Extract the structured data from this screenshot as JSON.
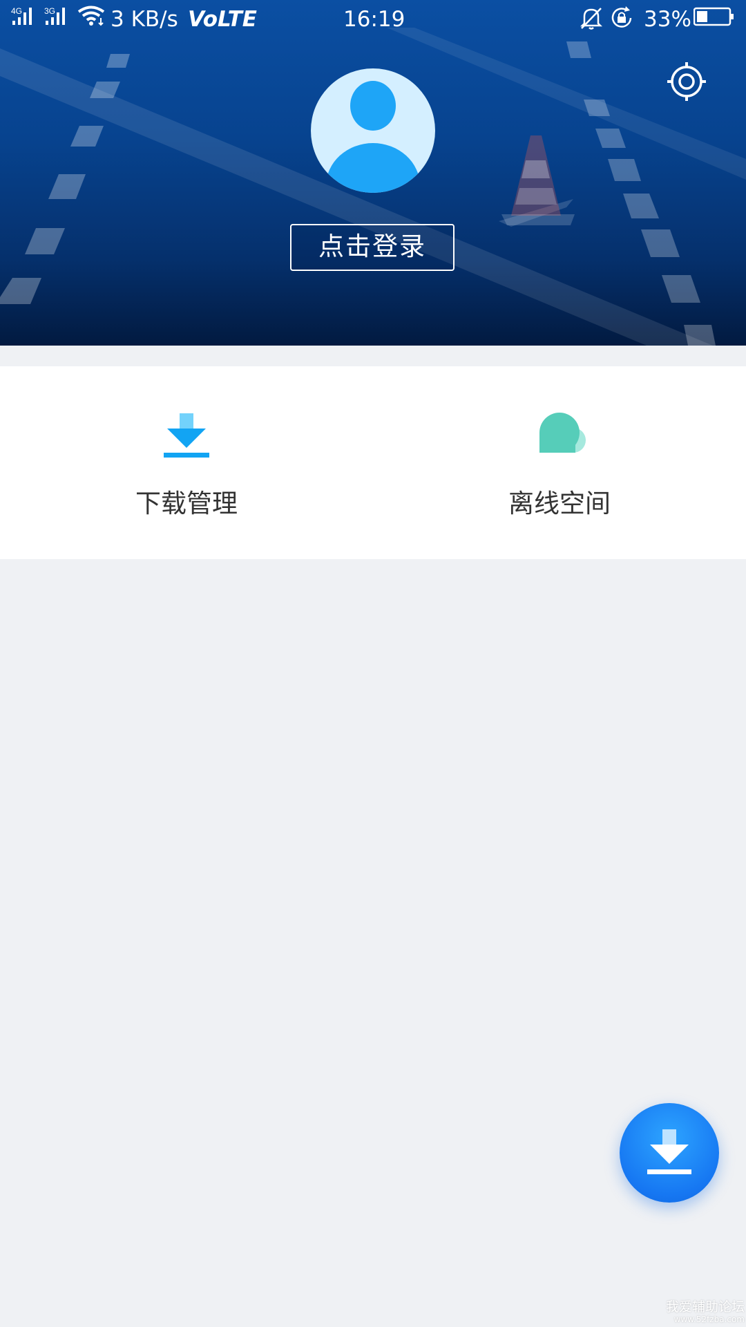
{
  "status_bar": {
    "network_1": "4G",
    "network_2": "3G",
    "speed": "3 KB/s",
    "volte": "VoLTE",
    "time": "16:19",
    "battery": "33%",
    "battery_level": 0.33
  },
  "header": {
    "login_label": "点击登录"
  },
  "quick_actions": [
    {
      "label": "下载管理",
      "icon": "download-icon"
    },
    {
      "label": "离线空间",
      "icon": "cloud-icon"
    }
  ],
  "fab": {
    "icon": "download-icon"
  },
  "watermark": {
    "title": "我爱辅助论坛",
    "url": "www.52fzba.com"
  },
  "colors": {
    "header_top": "#0b4fa3",
    "header_bottom": "#021a40",
    "page_bg": "#eff1f4",
    "download_blue": "#12a4f3",
    "cloud_teal": "#56cdb9",
    "fab_blue": "#1677f2"
  }
}
